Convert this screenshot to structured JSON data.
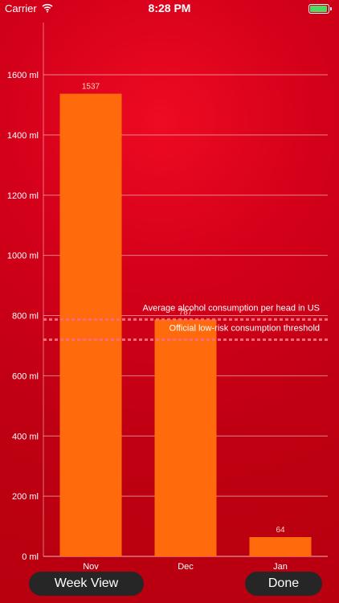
{
  "status_bar": {
    "carrier": "Carrier",
    "time": "8:28 PM",
    "battery_color": "#4cd964"
  },
  "buttons": {
    "week_view": "Week View",
    "done": "Done"
  },
  "chart_data": {
    "type": "bar",
    "categories": [
      "Nov",
      "Dec",
      "Jan"
    ],
    "values": [
      1537,
      787,
      64
    ],
    "value_labels": [
      "1537",
      "787",
      "64"
    ],
    "ylim": [
      0,
      1600
    ],
    "y_ticks": [
      0,
      200,
      400,
      600,
      800,
      1000,
      1200,
      1400,
      1600
    ],
    "y_tick_labels": [
      "0 ml",
      "200 ml",
      "400 ml",
      "600 ml",
      "800 ml",
      "1000 ml",
      "1200 ml",
      "1400 ml",
      "1600 ml"
    ],
    "grid": true,
    "bar_color": "#ff6a0d",
    "reference_lines": [
      {
        "label": "Average alcohol consumption per head in US",
        "value": 787,
        "color": "#ff6b78"
      },
      {
        "label": "Official low-risk consumption threshold",
        "value": 720,
        "color": "#ff6b78"
      }
    ]
  }
}
